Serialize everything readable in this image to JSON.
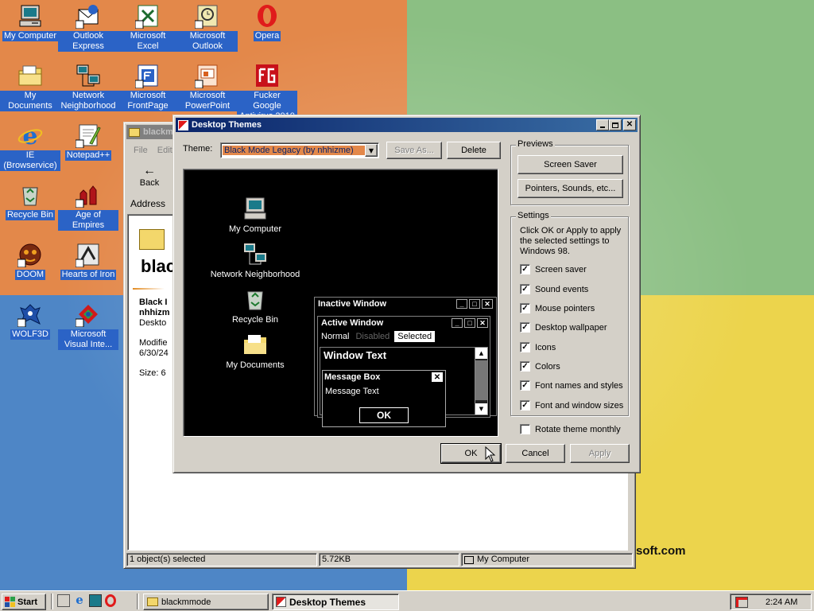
{
  "desktop": {
    "icons": [
      {
        "name": "my-computer",
        "label": "My Computer",
        "icon": "computer-icon"
      },
      {
        "name": "outlook-express",
        "label": "Outlook Express",
        "icon": "outlook-express-icon"
      },
      {
        "name": "microsoft-excel",
        "label": "Microsoft Excel",
        "icon": "excel-icon"
      },
      {
        "name": "microsoft-outlook",
        "label": "Microsoft Outlook",
        "icon": "outlook-icon"
      },
      {
        "name": "opera",
        "label": "Opera",
        "icon": "opera-icon"
      },
      {
        "name": "my-documents",
        "label": "My Documents",
        "icon": "documents-folder-icon"
      },
      {
        "name": "network-neighborhood",
        "label": "Network Neighborhood",
        "icon": "network-icon"
      },
      {
        "name": "microsoft-frontpage",
        "label": "Microsoft FrontPage",
        "icon": "frontpage-icon"
      },
      {
        "name": "microsoft-powerpoint",
        "label": "Microsoft PowerPoint",
        "icon": "powerpoint-icon"
      },
      {
        "name": "antivirus",
        "label": "Fucker Google Antivirus 2010",
        "icon": "fg-antivirus-icon"
      },
      {
        "name": "ie-browservice",
        "label": "IE (Browservice)",
        "icon": "ie-icon"
      },
      {
        "name": "notepad-plus-plus",
        "label": "Notepad++",
        "icon": "notepad-icon"
      },
      {
        "name": "recycle-bin",
        "label": "Recycle Bin",
        "icon": "recycle-bin-icon"
      },
      {
        "name": "age-of-empires",
        "label": "Age of Empires",
        "icon": "age-of-empires-icon"
      },
      {
        "name": "doom",
        "label": "DOOM",
        "icon": "doom-icon"
      },
      {
        "name": "hearts-of-iron",
        "label": "Hearts of Iron",
        "icon": "hearts-of-iron-icon"
      },
      {
        "name": "wolf3d",
        "label": "WOLF3D",
        "icon": "wolf3d-icon"
      },
      {
        "name": "visual-interdev",
        "label": "Microsoft Visual Inte...",
        "icon": "visual-interdev-icon"
      }
    ],
    "wallpaper_text": "soft.com",
    "colors": {
      "orange": "#e3884a",
      "green": "#8bbf83",
      "blue": "#4e86c6",
      "yellow": "#ecd44c",
      "title_active": "#0a246a",
      "title_inactive": "#808080"
    }
  },
  "explorer": {
    "title": "blackm",
    "menu": [
      "File",
      "Edit"
    ],
    "back_label": "Back",
    "address_label": "Address",
    "heading": "blac",
    "info_lines": [
      "Black I",
      "nhhizm",
      "Deskto"
    ],
    "modified_lines": [
      "Modifie",
      "6/30/24"
    ],
    "size_text": "Size: 6",
    "status": {
      "selected": "1 object(s) selected",
      "size": "5.72KB",
      "location": "My Computer"
    }
  },
  "dialog": {
    "title": "Desktop Themes",
    "theme_label": "Theme:",
    "theme_value": "Black Mode Legacy (by nhhizme)",
    "save_as_label": "Save As...",
    "delete_label": "Delete",
    "previews": {
      "group_label": "Previews",
      "screen_saver": "Screen Saver",
      "pointers": "Pointers, Sounds, etc..."
    },
    "settings": {
      "group_label": "Settings",
      "description": "Click OK or Apply to apply the selected settings to Windows 98.",
      "checkboxes": [
        {
          "label": "Screen saver",
          "checked": true
        },
        {
          "label": "Sound events",
          "checked": true
        },
        {
          "label": "Mouse pointers",
          "checked": true
        },
        {
          "label": "Desktop wallpaper",
          "checked": true
        },
        {
          "label": "Icons",
          "checked": true
        },
        {
          "label": "Colors",
          "checked": true
        },
        {
          "label": "Font names and styles",
          "checked": true
        },
        {
          "label": "Font and window sizes",
          "checked": true
        }
      ]
    },
    "rotate_label": "Rotate theme monthly",
    "rotate_checked": false,
    "ok_label": "OK",
    "cancel_label": "Cancel",
    "apply_label": "Apply",
    "preview": {
      "icons": [
        {
          "label": "My Computer",
          "icon": "computer-icon"
        },
        {
          "label": "Network Neighborhood",
          "icon": "network-icon"
        },
        {
          "label": "Recycle Bin",
          "icon": "recycle-bin-icon"
        },
        {
          "label": "My Documents",
          "icon": "documents-folder-icon"
        }
      ],
      "inactive_title": "Inactive Window",
      "active_title": "Active Window",
      "menu_normal": "Normal",
      "menu_disabled": "Disabled",
      "menu_selected": "Selected",
      "window_text": "Window Text",
      "message_box_title": "Message Box",
      "message_text": "Message Text",
      "message_ok": "OK"
    }
  },
  "taskbar": {
    "start_label": "Start",
    "tasks": [
      {
        "label": "blackmmode",
        "active": false
      },
      {
        "label": "Desktop Themes",
        "active": true
      }
    ],
    "clock": "2:24 AM"
  }
}
